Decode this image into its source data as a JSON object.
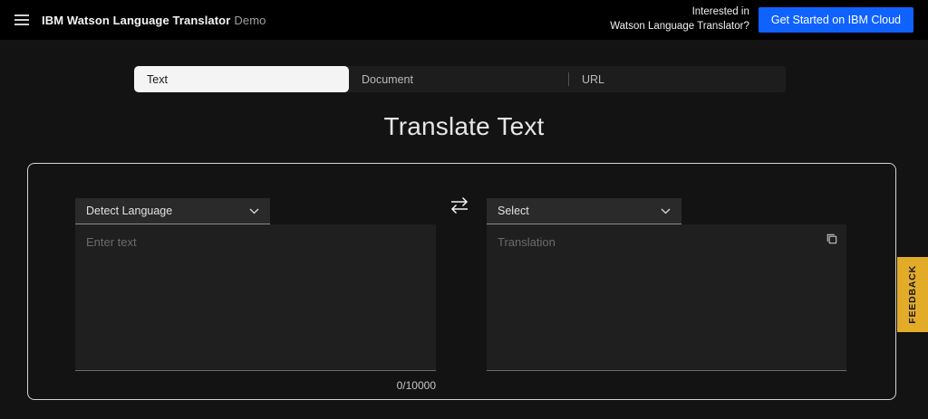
{
  "header": {
    "brand_bold": "IBM Watson Language Translator",
    "brand_light": "Demo",
    "promo_line1": "Interested in",
    "promo_line2": "Watson Language Translator?",
    "cta_label": "Get Started on IBM Cloud"
  },
  "tabs": [
    {
      "label": "Text",
      "active": true
    },
    {
      "label": "Document",
      "active": false
    },
    {
      "label": "URL",
      "active": false
    }
  ],
  "main": {
    "title": "Translate Text",
    "source": {
      "language_selector_value": "Detect Language",
      "textarea_placeholder": "Enter text",
      "textarea_value": "",
      "char_count": "0/10000"
    },
    "target": {
      "language_selector_value": "Select",
      "textarea_placeholder": "Translation",
      "textarea_value": ""
    }
  },
  "feedback_label": "FEEDBACK",
  "icons": {
    "menu": "hamburger-menu",
    "chevron_down": "chevron-down",
    "swap": "swap-arrows",
    "copy": "copy"
  },
  "colors": {
    "accent_blue": "#0f62fe",
    "feedback_yellow": "#e2ab28",
    "active_tab_bg": "#f4f4f4",
    "page_bg": "#131313",
    "header_bg": "#000000"
  }
}
